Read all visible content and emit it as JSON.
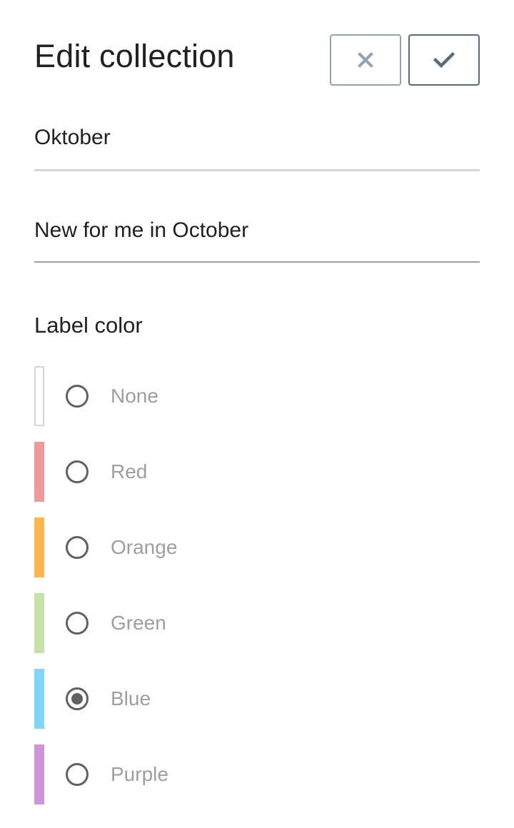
{
  "header": {
    "title": "Edit collection"
  },
  "actions": {
    "cancel_icon": "close-icon",
    "save_icon": "check-icon"
  },
  "form": {
    "name_value": "Oktober",
    "description_value": "New for me in October",
    "label_color_heading": "Label color"
  },
  "colors": {
    "selected": "Blue",
    "options": [
      {
        "label": "None",
        "swatch": "#ffffff",
        "border": "#cfd8dc"
      },
      {
        "label": "Red",
        "swatch": "#ef9a9a",
        "border": "#ef9a9a"
      },
      {
        "label": "Orange",
        "swatch": "#ffb74d",
        "border": "#ffb74d"
      },
      {
        "label": "Green",
        "swatch": "#c5e1a5",
        "border": "#c5e1a5"
      },
      {
        "label": "Blue",
        "swatch": "#81d4fa",
        "border": "#81d4fa"
      },
      {
        "label": "Purple",
        "swatch": "#ce93d8",
        "border": "#ce93d8"
      }
    ]
  },
  "theme": {
    "cancel_border": "#90a4ae",
    "save_border": "#546e7a",
    "cancel_icon_color": "#90a4ae",
    "save_icon_color": "#546e7a"
  }
}
